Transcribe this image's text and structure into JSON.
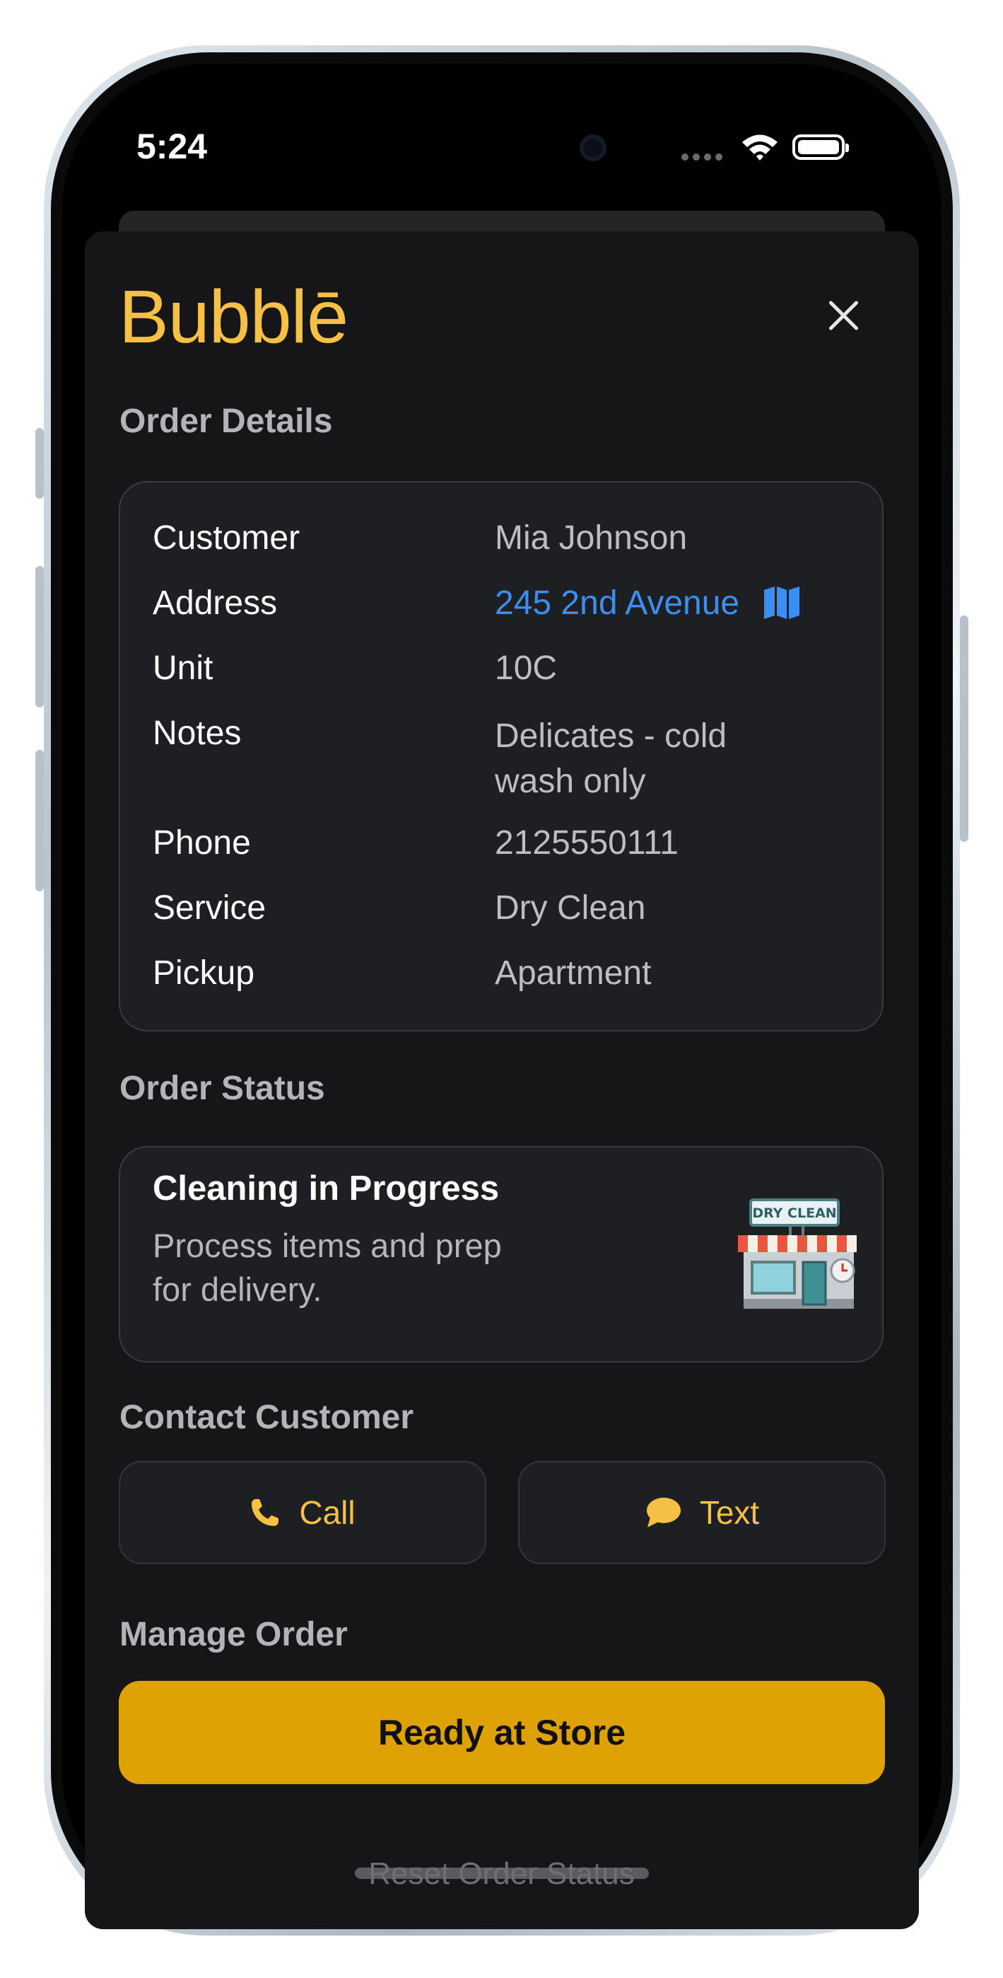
{
  "status_bar": {
    "time": "5:24"
  },
  "header": {
    "logo": "Bubblē"
  },
  "order_details": {
    "heading": "Order Details",
    "rows": [
      {
        "label": "Customer",
        "value": "Mia Johnson"
      },
      {
        "label": "Address",
        "value": "245 2nd Avenue"
      },
      {
        "label": "Unit",
        "value": "10C"
      },
      {
        "label": "Notes",
        "value": "Delicates - cold wash only"
      },
      {
        "label": "Phone",
        "value": "2125550111"
      },
      {
        "label": "Service",
        "value": "Dry Clean"
      },
      {
        "label": "Pickup",
        "value": "Apartment"
      }
    ]
  },
  "order_status": {
    "heading": "Order Status",
    "title": "Cleaning in Progress",
    "description": "Process items and prep for delivery.",
    "sign_text": "DRY CLEAN"
  },
  "contact": {
    "heading": "Contact Customer",
    "call_label": "Call",
    "text_label": "Text"
  },
  "manage": {
    "heading": "Manage Order",
    "primary_label": "Ready at Store",
    "reset_label": "Reset Order Status"
  },
  "colors": {
    "accent": "#f5c044",
    "link": "#3b8ff3",
    "primary_button": "#dfa205",
    "background": "#161618",
    "card": "#1e1f22"
  },
  "icons": [
    "close-icon",
    "map-icon",
    "phone-icon",
    "chat-bubble-icon",
    "dry-clean-store-icon",
    "wifi-icon",
    "battery-icon",
    "cellular-icon"
  ]
}
